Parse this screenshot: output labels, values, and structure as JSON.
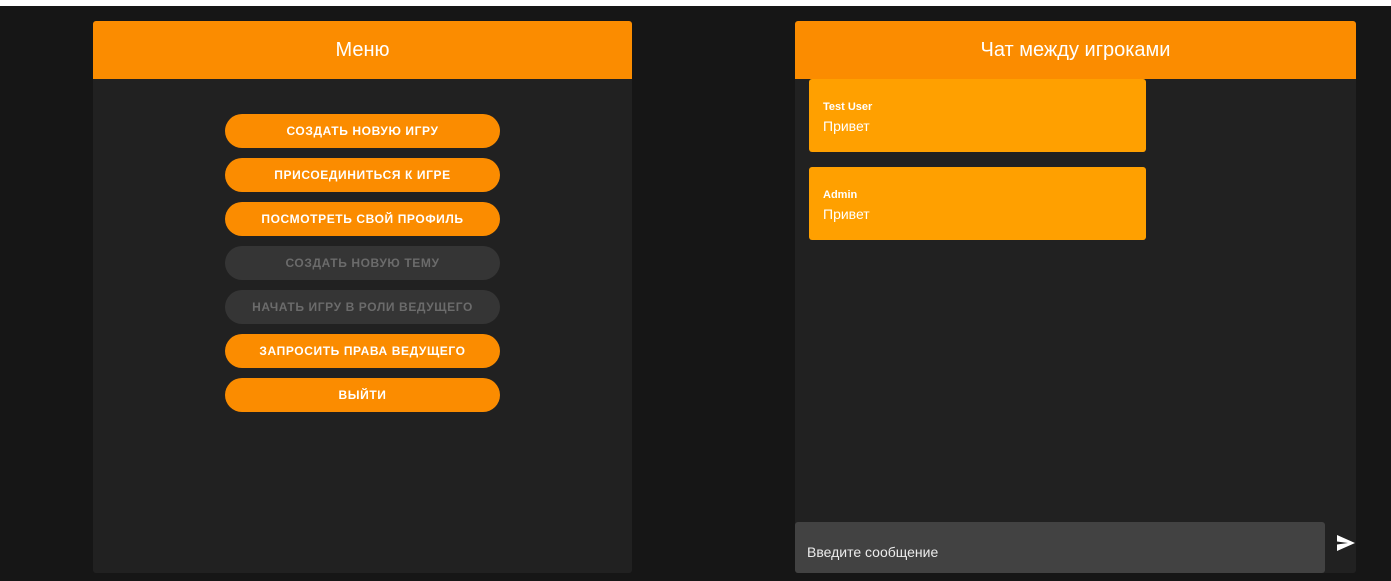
{
  "colors": {
    "accent": "#fb8c00",
    "message_bg": "#ffa000",
    "panel_bg": "#212121",
    "page_bg": "#161616",
    "disabled_bg": "#353535",
    "input_bg": "#424242"
  },
  "menu": {
    "title": "Меню",
    "buttons": [
      {
        "label": "СОЗДАТЬ НОВУЮ ИГРУ",
        "disabled": false
      },
      {
        "label": "ПРИСОЕДИНИТЬСЯ К ИГРЕ",
        "disabled": false
      },
      {
        "label": "ПОСМОТРЕТЬ СВОЙ ПРОФИЛЬ",
        "disabled": false
      },
      {
        "label": "СОЗДАТЬ НОВУЮ ТЕМУ",
        "disabled": true
      },
      {
        "label": "НАЧАТЬ ИГРУ В РОЛИ ВЕДУЩЕГО",
        "disabled": true
      },
      {
        "label": "ЗАПРОСИТЬ ПРАВА ВЕДУЩЕГО",
        "disabled": false
      },
      {
        "label": "ВЫЙТИ",
        "disabled": false
      }
    ]
  },
  "chat": {
    "title": "Чат между игроками",
    "messages": [
      {
        "author": "Test User",
        "text": "Привет"
      },
      {
        "author": "Admin",
        "text": "Привет"
      }
    ],
    "input_placeholder": "Введите сообщение",
    "send_icon": "send-icon"
  }
}
